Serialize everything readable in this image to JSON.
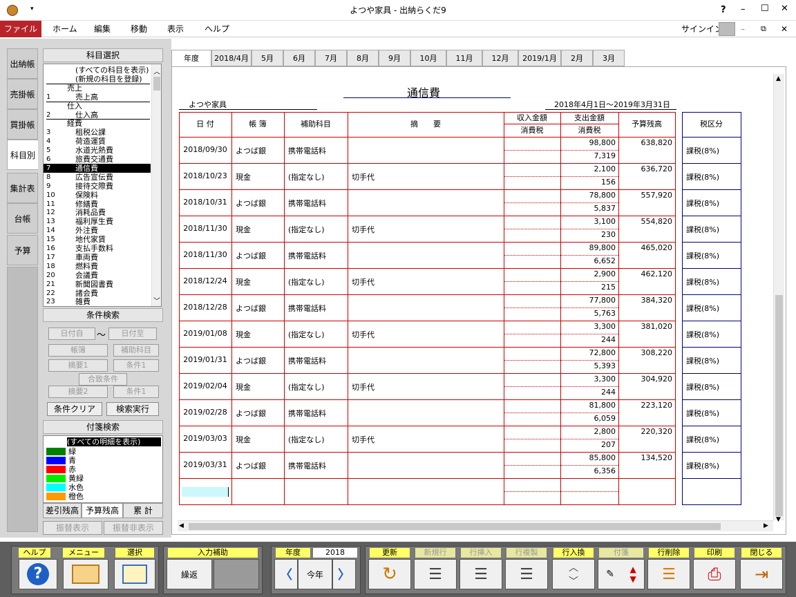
{
  "window": {
    "title": "よつや家具 - 出納らくだ9",
    "help": "?",
    "minimize": "–",
    "maximize": "☐",
    "close": "✕"
  },
  "menubar": {
    "items": [
      "ファイル",
      "ホーム",
      "編集",
      "移動",
      "表示",
      "ヘルプ"
    ],
    "signin": "サインイン"
  },
  "sidetabs": [
    "出納帳",
    "売掛帳",
    "買掛帳",
    "科目別",
    "集計表",
    "台帳",
    "予算"
  ],
  "subject_panel": {
    "header": "科目選択",
    "items": [
      {
        "num": "",
        "name": "(すべての科目を表示)",
        "indent": 1
      },
      {
        "num": "",
        "name": "(新規の科目を登録)",
        "indent": 1
      },
      {
        "num": "",
        "name": "売上",
        "indent": 0
      },
      {
        "num": "1",
        "name": "売上高",
        "indent": 1
      },
      {
        "num": "",
        "name": "仕入",
        "indent": 0
      },
      {
        "num": "2",
        "name": "仕入高",
        "indent": 1
      },
      {
        "num": "",
        "name": "経費",
        "indent": 0
      },
      {
        "num": "3",
        "name": "租税公課",
        "indent": 1
      },
      {
        "num": "4",
        "name": "荷造運賃",
        "indent": 1
      },
      {
        "num": "5",
        "name": "水道光熱費",
        "indent": 1
      },
      {
        "num": "6",
        "name": "旅費交通費",
        "indent": 1
      },
      {
        "num": "7",
        "name": "通信費",
        "indent": 1,
        "selected": true
      },
      {
        "num": "8",
        "name": "広告宣伝費",
        "indent": 1
      },
      {
        "num": "9",
        "name": "接待交際費",
        "indent": 1
      },
      {
        "num": "10",
        "name": "保険料",
        "indent": 1
      },
      {
        "num": "11",
        "name": "修繕費",
        "indent": 1
      },
      {
        "num": "12",
        "name": "消耗品費",
        "indent": 1
      },
      {
        "num": "13",
        "name": "福利厚生費",
        "indent": 1
      },
      {
        "num": "14",
        "name": "外注費",
        "indent": 1
      },
      {
        "num": "15",
        "name": "地代家賃",
        "indent": 1
      },
      {
        "num": "16",
        "name": "支払手数料",
        "indent": 1
      },
      {
        "num": "17",
        "name": "車両費",
        "indent": 1
      },
      {
        "num": "18",
        "name": "燃料費",
        "indent": 1
      },
      {
        "num": "20",
        "name": "会議費",
        "indent": 1
      },
      {
        "num": "21",
        "name": "新聞図書費",
        "indent": 1
      },
      {
        "num": "22",
        "name": "諸会費",
        "indent": 1
      },
      {
        "num": "23",
        "name": "雑費",
        "indent": 1
      }
    ]
  },
  "search_panel": {
    "header": "条件検索",
    "date_from": "日付自",
    "tilde": "〜",
    "date_to": "日付至",
    "book": "帳簿",
    "sub": "補助科目",
    "memo1": "摘要1",
    "cond1": "条件1",
    "match": "合致条件",
    "memo2": "摘要2",
    "cond2": "条件1",
    "clear": "条件クリア",
    "run": "検索実行"
  },
  "tag_panel": {
    "header": "付箋検索",
    "all": "(すべての明細を表示)",
    "tags": [
      {
        "name": "緑",
        "color": "#008000"
      },
      {
        "name": "青",
        "color": "#0000ff"
      },
      {
        "name": "赤",
        "color": "#ff0000"
      },
      {
        "name": "黄緑",
        "color": "#00ee00"
      },
      {
        "name": "水色",
        "color": "#00ffff"
      },
      {
        "name": "橙色",
        "color": "#ff9900"
      }
    ]
  },
  "bottom_tabs": [
    "差引残高",
    "予算残高",
    "累 計"
  ],
  "bottom_btns": [
    "振替表示",
    "振替非表示"
  ],
  "month_tabs": [
    "年度",
    "2018/4月",
    "5月",
    "6月",
    "7月",
    "8月",
    "9月",
    "10月",
    "11月",
    "12月",
    "2019/1月",
    "2月",
    "3月"
  ],
  "ledger": {
    "title": "通信費",
    "company": "よつや家具",
    "period": "2018年4月1日〜2019年3月31日",
    "headers": {
      "date": "日 付",
      "book": "帳 簿",
      "sub": "補助科目",
      "memo": "摘　　要",
      "income": "収入金額",
      "income_tax": "消費税",
      "expense": "支出金額",
      "expense_tax": "消費税",
      "balance": "予算残高",
      "taxclass": "税区分"
    },
    "rows": [
      {
        "date": "2018/09/30",
        "book": "よつば銀",
        "sub": "携帯電話料",
        "memo": "",
        "expense": "98,800",
        "tax": "7,319",
        "balance": "638,820",
        "taxclass": "課税(8%)"
      },
      {
        "date": "2018/10/23",
        "book": "現金",
        "sub": "(指定なし)",
        "memo": "切手代",
        "expense": "2,100",
        "tax": "156",
        "balance": "636,720",
        "taxclass": "課税(8%)"
      },
      {
        "date": "2018/10/31",
        "book": "よつば銀",
        "sub": "携帯電話料",
        "memo": "",
        "expense": "78,800",
        "tax": "5,837",
        "balance": "557,920",
        "taxclass": "課税(8%)"
      },
      {
        "date": "2018/11/30",
        "book": "現金",
        "sub": "(指定なし)",
        "memo": "切手代",
        "expense": "3,100",
        "tax": "230",
        "balance": "554,820",
        "taxclass": "課税(8%)"
      },
      {
        "date": "2018/11/30",
        "book": "よつば銀",
        "sub": "携帯電話料",
        "memo": "",
        "expense": "89,800",
        "tax": "6,652",
        "balance": "465,020",
        "taxclass": "課税(8%)"
      },
      {
        "date": "2018/12/24",
        "book": "現金",
        "sub": "(指定なし)",
        "memo": "切手代",
        "expense": "2,900",
        "tax": "215",
        "balance": "462,120",
        "taxclass": "課税(8%)"
      },
      {
        "date": "2018/12/28",
        "book": "よつば銀",
        "sub": "携帯電話料",
        "memo": "",
        "expense": "77,800",
        "tax": "5,763",
        "balance": "384,320",
        "taxclass": "課税(8%)"
      },
      {
        "date": "2019/01/08",
        "book": "現金",
        "sub": "(指定なし)",
        "memo": "切手代",
        "expense": "3,300",
        "tax": "244",
        "balance": "381,020",
        "taxclass": "課税(8%)"
      },
      {
        "date": "2019/01/31",
        "book": "よつば銀",
        "sub": "携帯電話料",
        "memo": "",
        "expense": "72,800",
        "tax": "5,393",
        "balance": "308,220",
        "taxclass": "課税(8%)"
      },
      {
        "date": "2019/02/04",
        "book": "現金",
        "sub": "(指定なし)",
        "memo": "切手代",
        "expense": "3,300",
        "tax": "244",
        "balance": "304,920",
        "taxclass": "課税(8%)"
      },
      {
        "date": "2019/02/28",
        "book": "よつば銀",
        "sub": "携帯電話料",
        "memo": "",
        "expense": "81,800",
        "tax": "6,059",
        "balance": "223,120",
        "taxclass": "課税(8%)"
      },
      {
        "date": "2019/03/03",
        "book": "現金",
        "sub": "(指定なし)",
        "memo": "切手代",
        "expense": "2,800",
        "tax": "207",
        "balance": "220,320",
        "taxclass": "課税(8%)"
      },
      {
        "date": "2019/03/31",
        "book": "よつば銀",
        "sub": "携帯電話料",
        "memo": "",
        "expense": "85,800",
        "tax": "6,356",
        "balance": "134,520",
        "taxclass": "課税(8%)"
      }
    ]
  },
  "toolbar": {
    "help": "ヘルプ",
    "menu": "メニュー",
    "select": "選択",
    "input_assist": "入力補助",
    "repeat": "繰返",
    "year_label": "年度",
    "year": "2018",
    "this_year": "今年",
    "update": "更新",
    "new_row": "新規行",
    "insert_row": "行挿入",
    "copy_row": "行複製",
    "swap_row": "行入換",
    "tag": "付箋",
    "delete_row": "行削除",
    "print": "印刷",
    "close": "閉じる"
  },
  "colors": {
    "accent": "#b9242b",
    "grid": "#cc0000",
    "toolbar_label": "#ffff66"
  }
}
